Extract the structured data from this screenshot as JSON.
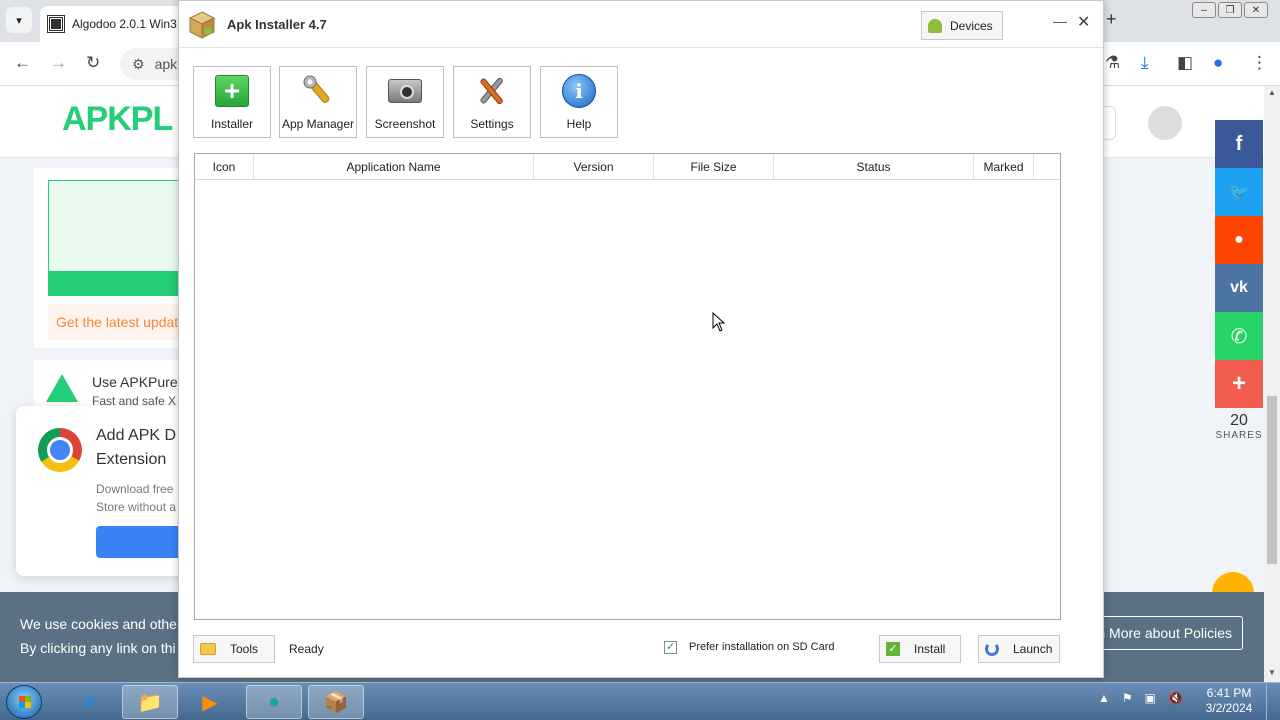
{
  "browser": {
    "tab_title": "Algodoo 2.0.1 Win3",
    "url_partial": "apk",
    "site": {
      "logo_text": "APKPL",
      "update_text": "Get the latest updat",
      "use_title": "Use APKPure",
      "use_sub": "Fast and safe X",
      "extension_title_line1": "Add APK D",
      "extension_title_line2": "Extension",
      "extension_desc_line1": "Download free",
      "extension_desc_line2": "Store without a",
      "share_count": "20",
      "share_label": "SHARES",
      "cookie_line1": "We use cookies and othe",
      "cookie_line2": "By clicking any link on thi",
      "policies_button": "n More about Policies"
    },
    "share_buttons": [
      {
        "name": "facebook",
        "glyph": "f",
        "color": "#3b5998"
      },
      {
        "name": "twitter",
        "glyph": "🐦",
        "color": "#1da1f2"
      },
      {
        "name": "reddit",
        "glyph": "●",
        "color": "#ff4500"
      },
      {
        "name": "vk",
        "glyph": "vk",
        "color": "#4c75a3"
      },
      {
        "name": "whatsapp",
        "glyph": "✆",
        "color": "#25d366"
      },
      {
        "name": "more",
        "glyph": "+",
        "color": "#f15c4f"
      }
    ]
  },
  "app": {
    "title": "Apk Installer 4.7",
    "devices_button": "Devices",
    "toolbar": [
      {
        "label": "Installer",
        "icon": "installer-icon"
      },
      {
        "label": "App Manager",
        "icon": "wrench-icon"
      },
      {
        "label": "Screenshot",
        "icon": "camera-icon"
      },
      {
        "label": "Settings",
        "icon": "tools-icon"
      },
      {
        "label": "Help",
        "icon": "help-icon"
      }
    ],
    "columns": [
      "Icon",
      "Application Name",
      "Version",
      "File Size",
      "Status",
      "Marked"
    ],
    "rows": [],
    "tools_button": "Tools",
    "status": "Ready",
    "prefer_sd_label": "Prefer installation on SD Card",
    "prefer_sd_checked": true,
    "install_button": "Install",
    "launch_button": "Launch"
  },
  "taskbar": {
    "time": "6:41 PM",
    "date": "3/2/2024"
  }
}
